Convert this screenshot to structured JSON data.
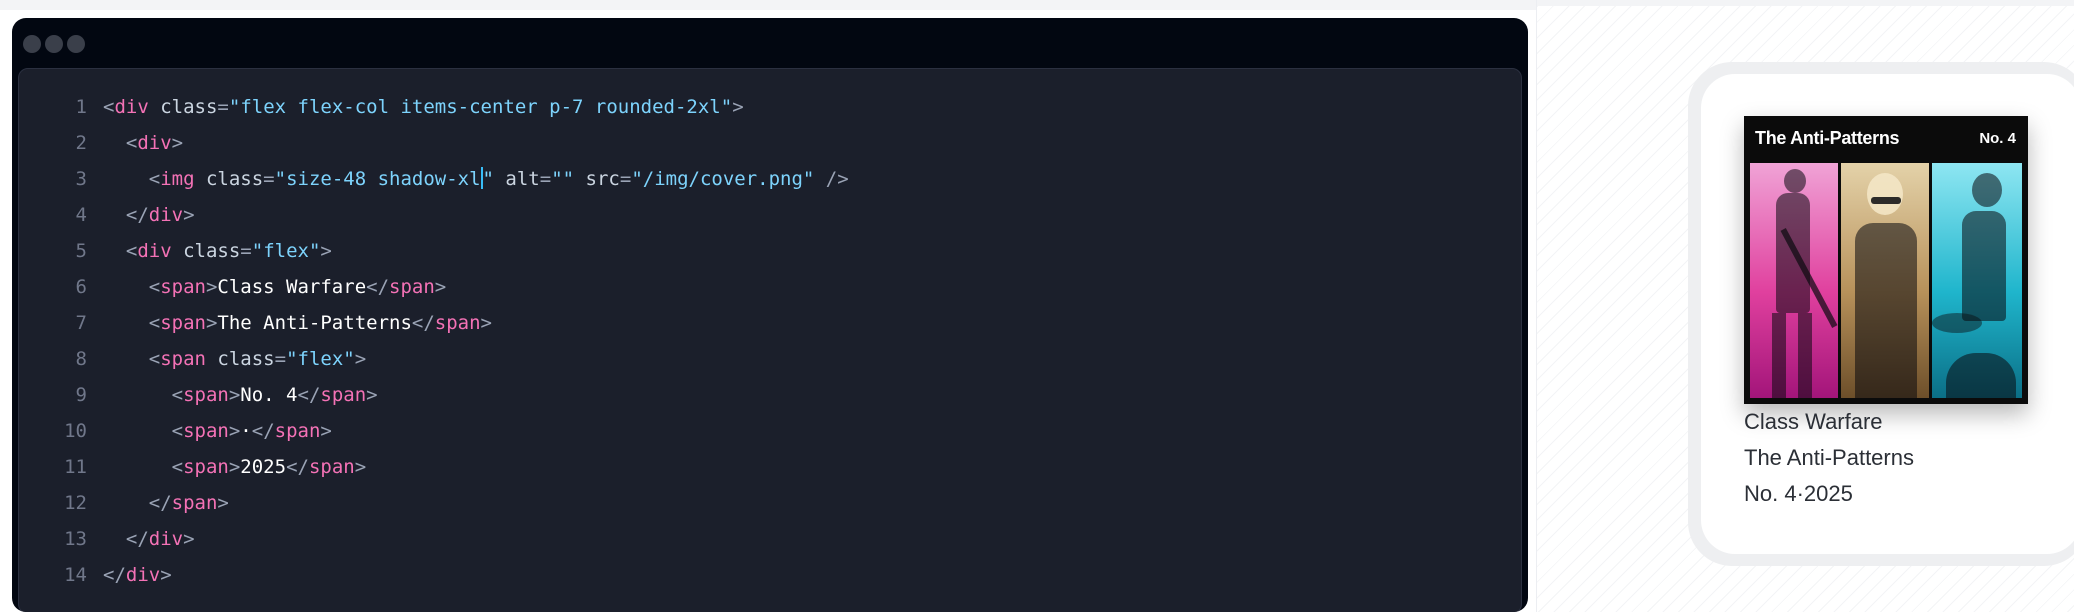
{
  "editor": {
    "window_dots": [
      "#3a3f4a",
      "#3a3f4a",
      "#3a3f4a"
    ],
    "lines": [
      {
        "n": "1",
        "tokens": [
          {
            "t": "<",
            "c": "pun"
          },
          {
            "t": "div",
            "c": "tag"
          },
          {
            "t": " class",
            "c": "attr"
          },
          {
            "t": "=",
            "c": "pun"
          },
          {
            "t": "\"flex flex-col items-center p-7 rounded-2xl\"",
            "c": "str"
          },
          {
            "t": ">",
            "c": "pun"
          }
        ]
      },
      {
        "n": "2",
        "tokens": [
          {
            "t": "  <",
            "c": "pun"
          },
          {
            "t": "div",
            "c": "tag"
          },
          {
            "t": ">",
            "c": "pun"
          }
        ]
      },
      {
        "n": "3",
        "tokens": [
          {
            "t": "    <",
            "c": "pun"
          },
          {
            "t": "img",
            "c": "tag"
          },
          {
            "t": " class",
            "c": "attr"
          },
          {
            "t": "=",
            "c": "pun"
          },
          {
            "t": "\"size-48 shadow-xl",
            "c": "str"
          },
          {
            "caret": true
          },
          {
            "t": "\"",
            "c": "str"
          },
          {
            "t": " alt",
            "c": "attr"
          },
          {
            "t": "=",
            "c": "pun"
          },
          {
            "t": "\"\"",
            "c": "str"
          },
          {
            "t": " src",
            "c": "attr"
          },
          {
            "t": "=",
            "c": "pun"
          },
          {
            "t": "\"/img/cover.png\"",
            "c": "str"
          },
          {
            "t": " />",
            "c": "pun"
          }
        ]
      },
      {
        "n": "4",
        "tokens": [
          {
            "t": "  </",
            "c": "pun"
          },
          {
            "t": "div",
            "c": "tag"
          },
          {
            "t": ">",
            "c": "pun"
          }
        ]
      },
      {
        "n": "5",
        "tokens": [
          {
            "t": "  <",
            "c": "pun"
          },
          {
            "t": "div",
            "c": "tag"
          },
          {
            "t": " class",
            "c": "attr"
          },
          {
            "t": "=",
            "c": "pun"
          },
          {
            "t": "\"flex\"",
            "c": "str"
          },
          {
            "t": ">",
            "c": "pun"
          }
        ]
      },
      {
        "n": "6",
        "tokens": [
          {
            "t": "    <",
            "c": "pun"
          },
          {
            "t": "span",
            "c": "tag"
          },
          {
            "t": ">",
            "c": "pun"
          },
          {
            "t": "Class Warfare",
            "c": "txt"
          },
          {
            "t": "</",
            "c": "pun"
          },
          {
            "t": "span",
            "c": "tag"
          },
          {
            "t": ">",
            "c": "pun"
          }
        ]
      },
      {
        "n": "7",
        "tokens": [
          {
            "t": "    <",
            "c": "pun"
          },
          {
            "t": "span",
            "c": "tag"
          },
          {
            "t": ">",
            "c": "pun"
          },
          {
            "t": "The Anti-Patterns",
            "c": "txt"
          },
          {
            "t": "</",
            "c": "pun"
          },
          {
            "t": "span",
            "c": "tag"
          },
          {
            "t": ">",
            "c": "pun"
          }
        ]
      },
      {
        "n": "8",
        "tokens": [
          {
            "t": "    <",
            "c": "pun"
          },
          {
            "t": "span",
            "c": "tag"
          },
          {
            "t": " class",
            "c": "attr"
          },
          {
            "t": "=",
            "c": "pun"
          },
          {
            "t": "\"flex\"",
            "c": "str"
          },
          {
            "t": ">",
            "c": "pun"
          }
        ]
      },
      {
        "n": "9",
        "tokens": [
          {
            "t": "      <",
            "c": "pun"
          },
          {
            "t": "span",
            "c": "tag"
          },
          {
            "t": ">",
            "c": "pun"
          },
          {
            "t": "No. 4",
            "c": "txt"
          },
          {
            "t": "</",
            "c": "pun"
          },
          {
            "t": "span",
            "c": "tag"
          },
          {
            "t": ">",
            "c": "pun"
          }
        ]
      },
      {
        "n": "10",
        "tokens": [
          {
            "t": "      <",
            "c": "pun"
          },
          {
            "t": "span",
            "c": "tag"
          },
          {
            "t": ">",
            "c": "pun"
          },
          {
            "t": "·",
            "c": "txt"
          },
          {
            "t": "</",
            "c": "pun"
          },
          {
            "t": "span",
            "c": "tag"
          },
          {
            "t": ">",
            "c": "pun"
          }
        ]
      },
      {
        "n": "11",
        "tokens": [
          {
            "t": "      <",
            "c": "pun"
          },
          {
            "t": "span",
            "c": "tag"
          },
          {
            "t": ">",
            "c": "pun"
          },
          {
            "t": "2025",
            "c": "txt"
          },
          {
            "t": "</",
            "c": "pun"
          },
          {
            "t": "span",
            "c": "tag"
          },
          {
            "t": ">",
            "c": "pun"
          }
        ]
      },
      {
        "n": "12",
        "tokens": [
          {
            "t": "    </",
            "c": "pun"
          },
          {
            "t": "span",
            "c": "tag"
          },
          {
            "t": ">",
            "c": "pun"
          }
        ]
      },
      {
        "n": "13",
        "tokens": [
          {
            "t": "  </",
            "c": "pun"
          },
          {
            "t": "div",
            "c": "tag"
          },
          {
            "t": ">",
            "c": "pun"
          }
        ]
      },
      {
        "n": "14",
        "tokens": [
          {
            "t": "</",
            "c": "pun"
          },
          {
            "t": "div",
            "c": "tag"
          },
          {
            "t": ">",
            "c": "pun"
          }
        ]
      }
    ]
  },
  "preview": {
    "cover": {
      "title": "The Anti-Patterns",
      "issue": "No. 4",
      "panel_colors": [
        "#e0409e",
        "#b7915a",
        "#1fb5cc"
      ]
    },
    "caption": {
      "line1": "Class Warfare",
      "line2": "The Anti-Patterns",
      "line3": "No. 4·2025"
    }
  }
}
